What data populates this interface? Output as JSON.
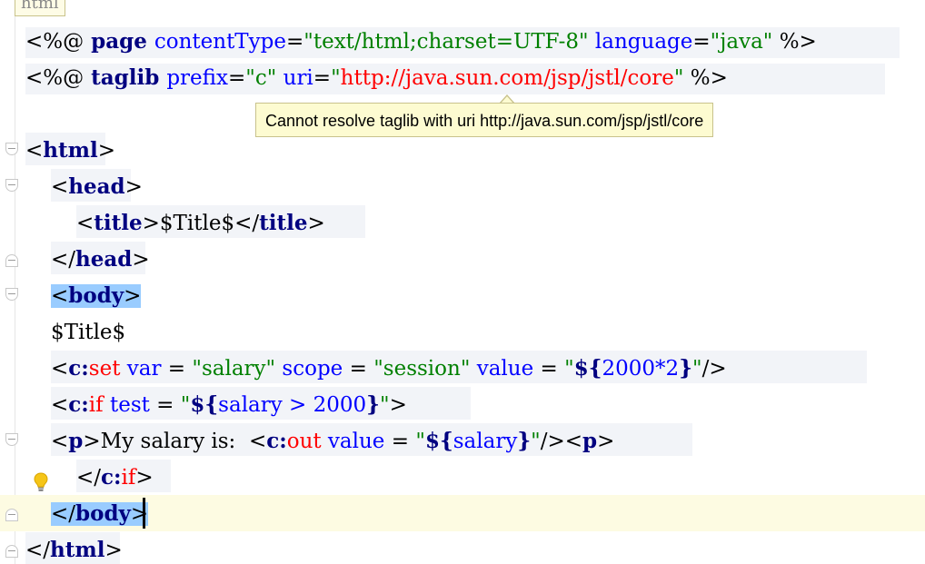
{
  "breadcrumb": "html",
  "tooltip": "Cannot resolve taglib with uri http://java.sun.com/jsp/jstl/core",
  "code": {
    "l1": {
      "open": "<%@",
      "page": " page ",
      "ctype_attr": "contentType",
      "eq": "=",
      "ctype_val": "\"text/html;charset=UTF-8\"",
      "sp": " ",
      "lang_attr": "language",
      "eq2": "=",
      "lang_val": "\"java\"",
      "close": " %>"
    },
    "l2": {
      "open": "<%@",
      "taglib": " taglib ",
      "prefix_attr": "prefix",
      "eq": "=",
      "prefix_val": "\"c\"",
      "sp": " ",
      "uri_attr": "uri",
      "eq2": "=",
      "q1": "\"",
      "uri_val": "http://java.sun.com/jsp/jstl/core",
      "q2": "\"",
      "close": " %>"
    },
    "l4": {
      "lt": "<",
      "tag": "html",
      "gt": ">"
    },
    "l5": {
      "lt": "<",
      "tag": "head",
      "gt": ">"
    },
    "l6": {
      "lt": "<",
      "tag": "title",
      "gt": ">",
      "text": "$Title$",
      "lt2": "</",
      "tag2": "title",
      "gt2": ">"
    },
    "l7": {
      "lt": "</",
      "tag": "head",
      "gt": ">"
    },
    "l8": {
      "lt": "<",
      "tag": "body",
      "gt": ">"
    },
    "l9": {
      "text": "$Title$"
    },
    "l10": {
      "lt": "<",
      "ns": "c:",
      "tag": "set",
      "a1": " var",
      "e1": " = ",
      "v1": "\"salary\"",
      "a2": " scope",
      "e2": " = ",
      "v2": "\"session\"",
      "a3": " value",
      "e3": " = ",
      "q": "\"",
      "el_open": "${",
      "el_num": "2000*2",
      "el_close": "}",
      "q2": "\"",
      "end": "/>"
    },
    "l11": {
      "lt": "<",
      "ns": "c:",
      "tag": "if",
      "a1": " test",
      "e1": " = ",
      "q": "\"",
      "el_open": "${",
      "el_body": "salary > 2000",
      "el_close": "}",
      "q2": "\"",
      "gt": ">"
    },
    "l12": {
      "lt": "<",
      "tag": "p",
      "gt": ">",
      "text": "My salary is:  ",
      "lt2": "<",
      "ns": "c:",
      "tag2": "out",
      "a1": " value",
      "e1": " = ",
      "q": "\"",
      "el_open": "${",
      "el_body": "salary",
      "el_close": "}",
      "q2": "\"",
      "end": "/>",
      "lt3": "<",
      "tag3": "p",
      "gt3": ">"
    },
    "l13": {
      "lt": "</",
      "ns": "c:",
      "tag": "if",
      "gt": ">"
    },
    "l14": {
      "lt": "</",
      "tag": "body",
      "gt": ">"
    },
    "l15": {
      "lt": "</",
      "tag": "html",
      "gt": ">"
    }
  },
  "icons": {
    "bulb": "lightbulb-icon",
    "fold": "fold-marker-icon"
  },
  "colors": {
    "tag": "#000080",
    "attribute": "#0000ff",
    "string": "#008000",
    "error_string": "#ff0000",
    "c_prefix_tag": "#ff0000",
    "selection": "#99ccff",
    "tooltip_bg": "#fdfbd1",
    "current_line": "#fdfbe2"
  }
}
